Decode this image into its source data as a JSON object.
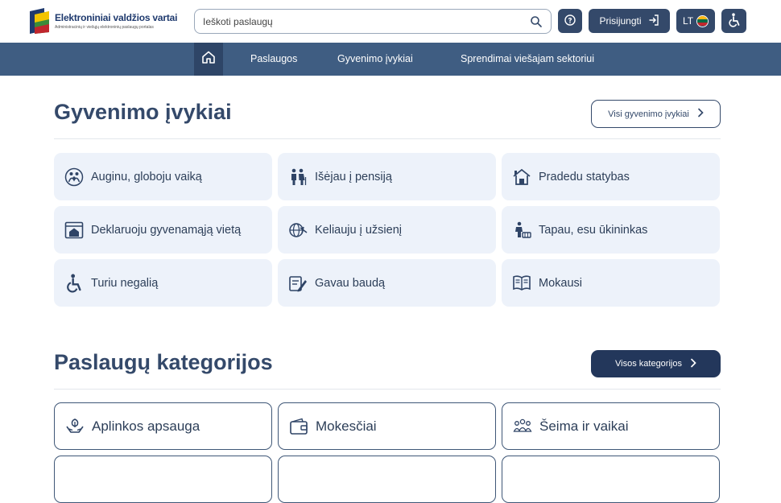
{
  "header": {
    "logo_title": "Elektroniniai valdžios vartai",
    "logo_subtitle": "Administracinių ir viešųjų elektroninių paslaugų portalas",
    "search_placeholder": "Ieškoti paslaugų",
    "login_label": "Prisijungti",
    "language_label": "LT"
  },
  "nav": {
    "items": [
      "Paslaugos",
      "Gyvenimo įvykiai",
      "Sprendimai viešajam sektoriui"
    ]
  },
  "life_events": {
    "title": "Gyvenimo įvykiai",
    "all_button": "Visi gyvenimo įvykiai",
    "cards": [
      {
        "label": "Auginu, globoju vaiką",
        "icon": "family-icon"
      },
      {
        "label": "Išėjau į pensiją",
        "icon": "elderly-couple-icon"
      },
      {
        "label": "Pradedu statybas",
        "icon": "house-building-icon"
      },
      {
        "label": "Deklaruoju gyvenamąją vietą",
        "icon": "address-declaration-icon"
      },
      {
        "label": "Keliauju į užsienį",
        "icon": "globe-plane-icon"
      },
      {
        "label": "Tapau, esu ūkininkas",
        "icon": "farmer-icon"
      },
      {
        "label": "Turiu negalią",
        "icon": "wheelchair-icon"
      },
      {
        "label": "Gavau baudą",
        "icon": "fine-document-icon"
      },
      {
        "label": "Mokausi",
        "icon": "book-icon"
      }
    ]
  },
  "categories": {
    "title": "Paslaugų kategorijos",
    "all_button": "Visos kategorijos",
    "cards": [
      {
        "label": "Aplinkos apsauga",
        "icon": "environment-hands-icon"
      },
      {
        "label": "Mokesčiai",
        "icon": "wallet-icon"
      },
      {
        "label": "Šeima ir vaikai",
        "icon": "family-group-icon"
      }
    ]
  },
  "colors": {
    "primary_dark": "#23375b",
    "nav_bar": "#3f5d82",
    "card_bg": "#edf2fa",
    "text": "#2c3e58"
  }
}
